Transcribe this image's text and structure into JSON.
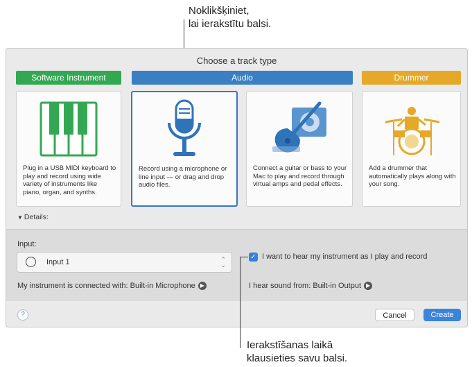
{
  "callouts": {
    "top": [
      "Noklikšķiniet,",
      "lai ierakstītu balsi."
    ],
    "bottom": [
      "Ierakstīšanas laikā",
      "klausieties savu balsi."
    ]
  },
  "dialog": {
    "title": "Choose a track type",
    "categories": {
      "software": "Software Instrument",
      "audio": "Audio",
      "drummer": "Drummer"
    },
    "colors": {
      "software": "#33a853",
      "audio": "#3a7fc1",
      "drummer": "#e5a828",
      "accent": "#3a84dc"
    },
    "cards": [
      {
        "icon": "piano-keys-icon",
        "desc": "Plug in a USB MIDI keyboard to play and record using wide variety of instruments like piano, organ, and synths.",
        "selected": false
      },
      {
        "icon": "microphone-icon",
        "desc": "Record using a microphone or line input — or drag and drop audio files.",
        "selected": true
      },
      {
        "icon": "guitar-icon",
        "desc": "Connect a guitar or bass to your Mac to play and record through virtual amps and pedal effects.",
        "selected": false
      },
      {
        "icon": "drum-kit-icon",
        "desc": "Add a drummer that automatically plays along with your song.",
        "selected": false
      }
    ],
    "details_label": "Details:",
    "input": {
      "label": "Input:",
      "value": "Input 1"
    },
    "monitor_checkbox": {
      "checked": true,
      "label": "I want to hear my instrument as I play and record"
    },
    "instrument_connected": "My instrument is connected with: Built-in Microphone",
    "hear_sound_from": "I hear sound from: Built-in Output",
    "help": "?",
    "cancel": "Cancel",
    "create": "Create"
  }
}
